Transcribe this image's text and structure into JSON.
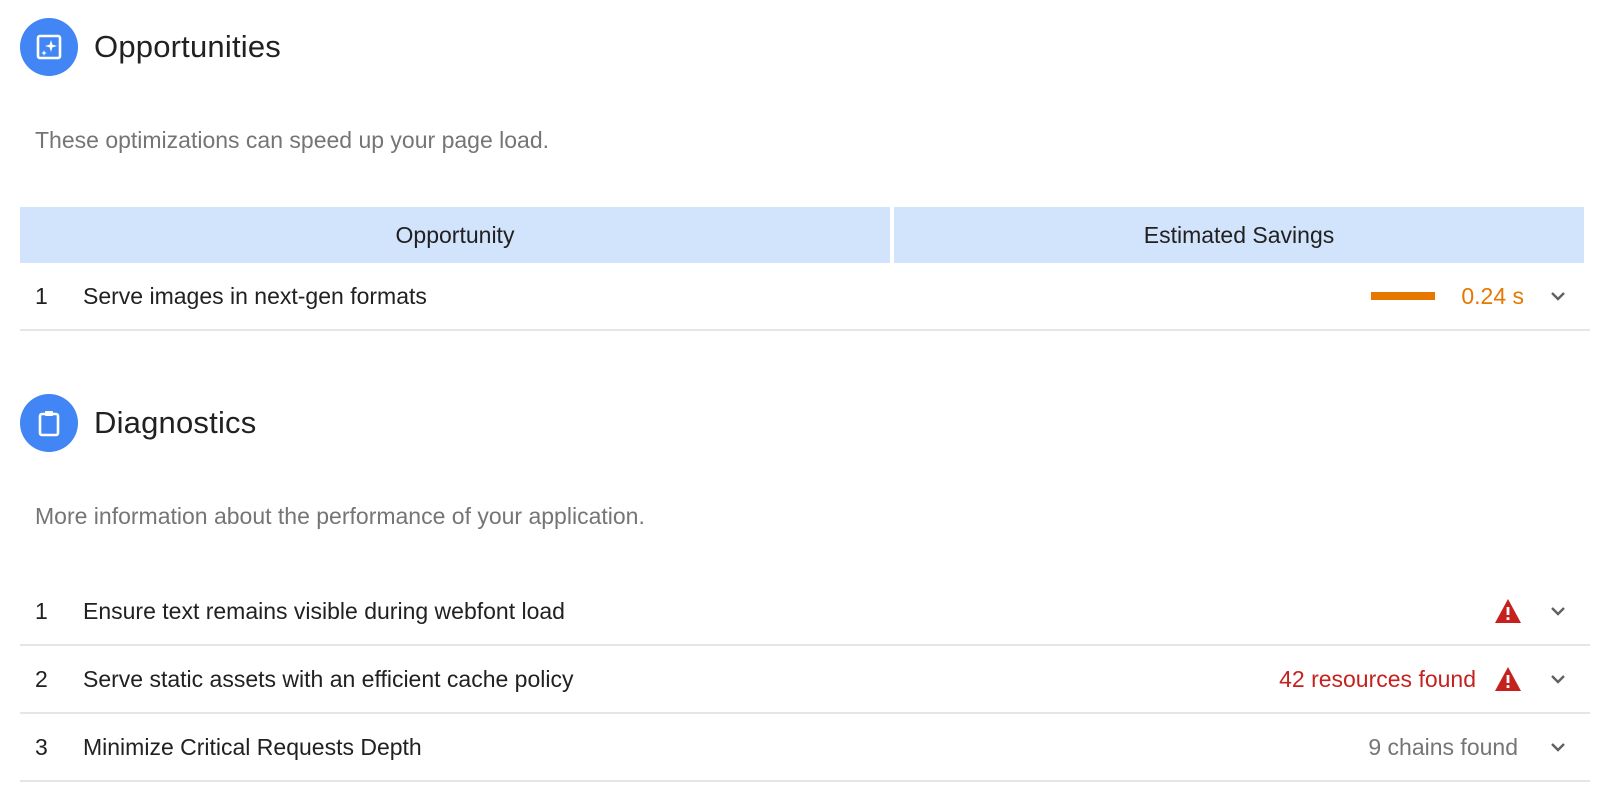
{
  "opportunities": {
    "title": "Opportunities",
    "icon": "sparkle-frame-icon",
    "description": "These optimizations can speed up your page load.",
    "columns": [
      "Opportunity",
      "Estimated Savings"
    ],
    "items": [
      {
        "index": "1",
        "title": "Serve images in next-gen formats",
        "savings": "0.24 s",
        "savings_fraction": 1.0
      }
    ]
  },
  "diagnostics": {
    "title": "Diagnostics",
    "icon": "clipboard-icon",
    "description": "More information about the performance of your application.",
    "items": [
      {
        "index": "1",
        "title": "Ensure text remains visible during webfont load",
        "status": "",
        "severity": "fail"
      },
      {
        "index": "2",
        "title": "Serve static assets with an efficient cache policy",
        "status": "42 resources found",
        "severity": "fail"
      },
      {
        "index": "3",
        "title": "Minimize Critical Requests Depth",
        "status": "9 chains found",
        "severity": "info"
      }
    ]
  },
  "colors": {
    "accent": "#4285f4",
    "header_bg": "#d2e3fc",
    "average": "#e67700",
    "fail": "#c5221f",
    "muted": "#757575"
  }
}
